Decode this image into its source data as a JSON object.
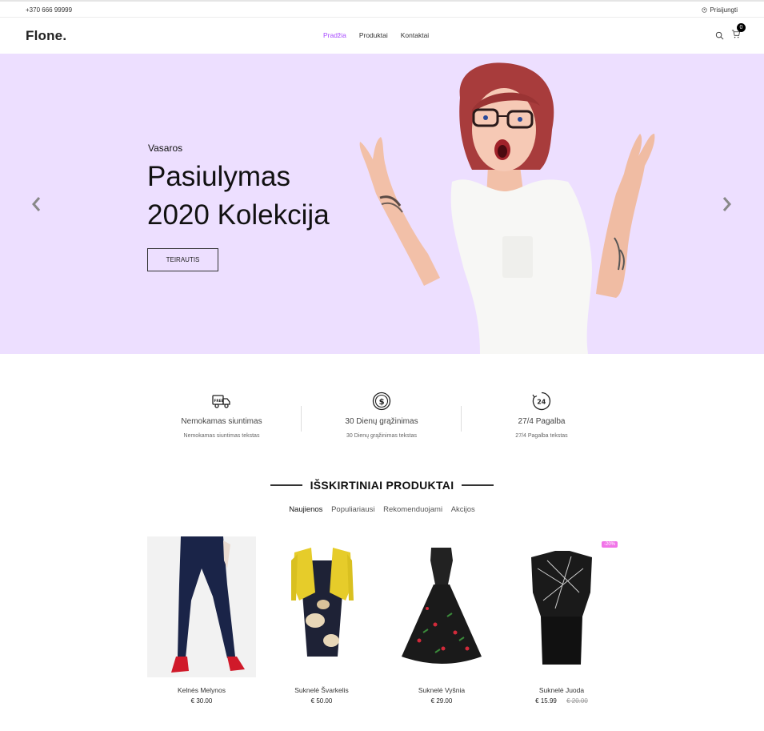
{
  "topbar": {
    "phone": "+370 666 99999",
    "login": "Prisijungti"
  },
  "header": {
    "logo": "Flone.",
    "nav": [
      "Pradžia",
      "Produktai",
      "Kontaktai"
    ],
    "cart_count": "0"
  },
  "hero": {
    "subtitle": "Vasaros",
    "title_line1": "Pasiulymas",
    "title_line2": "2020 Kolekcija",
    "button": "TEIRAUTIS"
  },
  "features": [
    {
      "title": "Nemokamas siuntimas",
      "desc": "Nemokamas siuntimas tekstas",
      "icon": "truck-icon"
    },
    {
      "title": "30 Dienų grąžinimas",
      "desc": "30 Dienų grąžinimas tekstas",
      "icon": "dollar-icon"
    },
    {
      "title": "27/4 Pagalba",
      "desc": "27/4 Pagalba tekstas",
      "icon": "support-24-icon"
    }
  ],
  "section": {
    "title": "IŠSKIRTINIAI PRODUKTAI",
    "tabs": [
      "Naujienos",
      "Populiariausi",
      "Rekomenduojami",
      "Akcijos"
    ]
  },
  "products": [
    {
      "name": "Kelnės Melynos",
      "price": "€  30.00"
    },
    {
      "name": "Suknelė Švarkelis",
      "price": "€  50.00"
    },
    {
      "name": "Suknelė Vyšnia",
      "price": "€  29.00"
    },
    {
      "name": "Suknelė Juoda",
      "price": "€  15.99",
      "old_price": "€ 20.00",
      "badge": "-20%"
    }
  ],
  "colors": {
    "accent": "#a749ff",
    "hero_bg": "#eddfff",
    "sale_badge": "#f174e8"
  }
}
